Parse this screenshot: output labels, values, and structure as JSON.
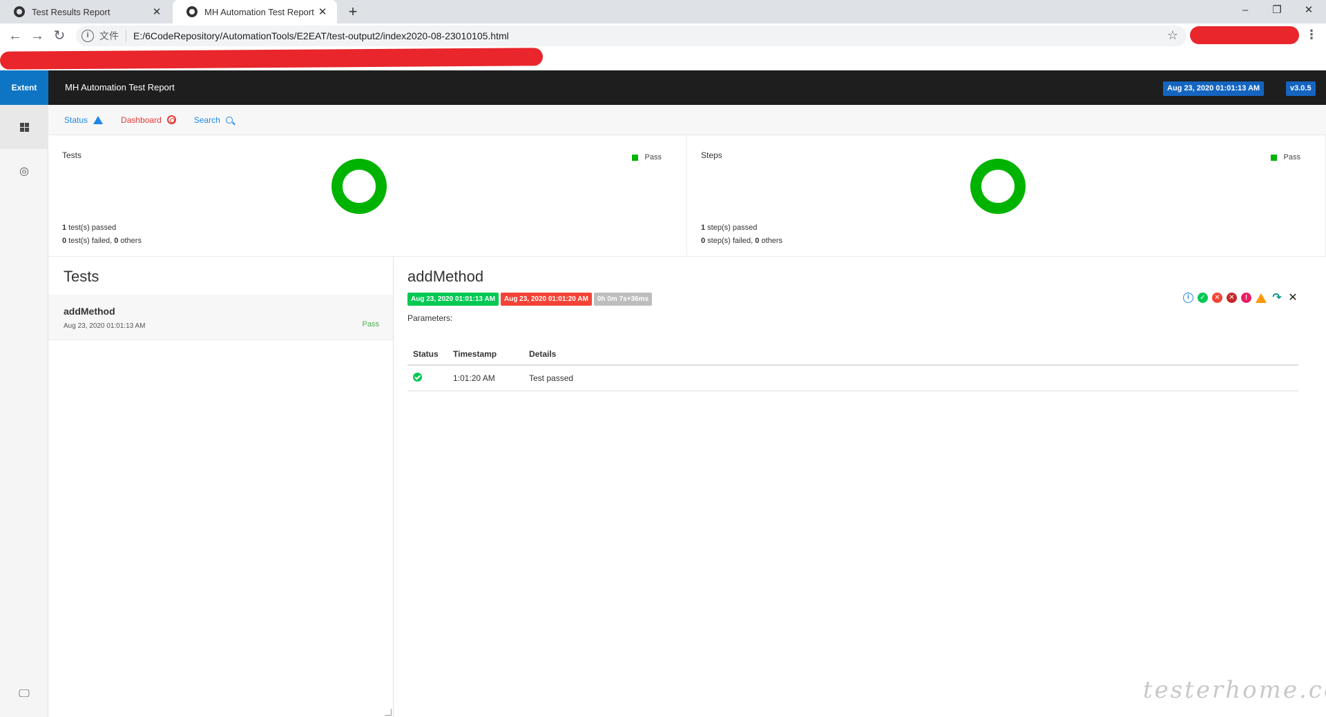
{
  "browser": {
    "tabs": [
      {
        "title": "Test Results Report",
        "active": false
      },
      {
        "title": "MH Automation Test Report",
        "active": true
      }
    ],
    "url_protocol": "文件",
    "url": "E:/6CodeRepository/AutomationTools/E2EAT/test-output2/index2020-08-23010105.html"
  },
  "header": {
    "brand": "Extent",
    "report_name": "MH Automation Test Report",
    "date_badge": "Aug 23, 2020 01:01:13 AM",
    "version_badge": "v3.0.5"
  },
  "subnav": {
    "status_label": "Status",
    "dashboard_label": "Dashboard",
    "search_label": "Search"
  },
  "summary": {
    "tests": {
      "title": "Tests",
      "legend": "Pass",
      "pass_count": "1",
      "line1_suffix": " test(s) passed",
      "fail_count": "0",
      "line2_mid": " test(s) failed, ",
      "others_count": "0",
      "line2_suffix": " others"
    },
    "steps": {
      "title": "Steps",
      "legend": "Pass",
      "pass_count": "1",
      "line1_suffix": " step(s) passed",
      "fail_count": "0",
      "line2_mid": " step(s) failed, ",
      "others_count": "0",
      "line2_suffix": " others"
    },
    "pass_color": "#00b300"
  },
  "tests_panel": {
    "heading": "Tests",
    "items": [
      {
        "name": "addMethod",
        "time": "Aug 23, 2020 01:01:13 AM",
        "status": "Pass"
      }
    ]
  },
  "detail": {
    "title": "addMethod",
    "start_time": "Aug 23, 2020 01:01:13 AM",
    "end_time": "Aug 23, 2020 01:01:20 AM",
    "duration": "0h 0m 7s+36ms",
    "parameters_label": "Parameters:",
    "columns": [
      "Status",
      "Timestamp",
      "Details"
    ],
    "rows": [
      {
        "status": "pass",
        "timestamp": "1:01:20 AM",
        "details": "Test passed"
      }
    ],
    "filter_icons": [
      "info-icon",
      "pass-icon",
      "fail-icon",
      "fatal-icon",
      "error-icon",
      "warning-icon",
      "skip-icon",
      "clear-icon"
    ]
  },
  "watermark": "testerhome.com"
}
